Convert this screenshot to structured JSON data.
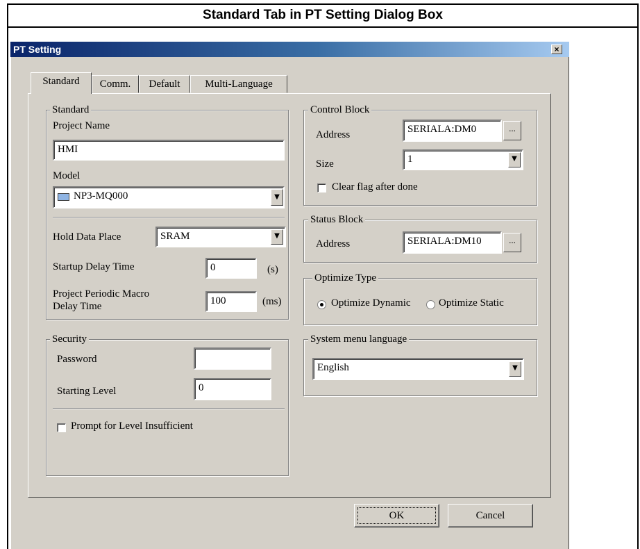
{
  "caption": "Standard Tab in PT Setting Dialog Box",
  "dialog": {
    "title": "PT Setting",
    "close_label": "×",
    "tabs": [
      {
        "label": "Standard",
        "active": true
      },
      {
        "label": "Comm.",
        "active": false
      },
      {
        "label": "Default",
        "active": false
      },
      {
        "label": "Multi-Language",
        "active": false
      }
    ]
  },
  "standard": {
    "legend": "Standard",
    "project_name_label": "Project Name",
    "project_name_value": "HMI",
    "model_label": "Model",
    "model_value": "NP3-MQ000",
    "model_icon": "display-icon",
    "hold_data_place_label": "Hold Data Place",
    "hold_data_place_value": "SRAM",
    "startup_delay_label": "Startup Delay Time",
    "startup_delay_value": "0",
    "startup_delay_unit": "(s)",
    "macro_delay_label_line1": "Project Periodic Macro",
    "macro_delay_label_line2": "Delay Time",
    "macro_delay_value": "100",
    "macro_delay_unit": "(ms)"
  },
  "security": {
    "legend": "Security",
    "password_label": "Password",
    "password_value": "",
    "starting_level_label": "Starting Level",
    "starting_level_value": "0",
    "prompt_label": "Prompt for Level Insufficient",
    "prompt_checked": false
  },
  "control_block": {
    "legend": "Control Block",
    "address_label": "Address",
    "address_value": "SERIALA:DM0",
    "browse_label": "...",
    "size_label": "Size",
    "size_value": "1",
    "clear_flag_label": "Clear flag after done",
    "clear_flag_checked": false
  },
  "status_block": {
    "legend": "Status Block",
    "address_label": "Address",
    "address_value": "SERIALA:DM10",
    "browse_label": "..."
  },
  "optimize": {
    "legend": "Optimize Type",
    "options": [
      "Optimize Dynamic",
      "Optimize Static"
    ],
    "selected": "Optimize Dynamic"
  },
  "system_menu": {
    "legend": "System menu language",
    "value": "English"
  },
  "buttons": {
    "ok": "OK",
    "cancel": "Cancel"
  },
  "icons": {
    "dropdown": "▼"
  }
}
